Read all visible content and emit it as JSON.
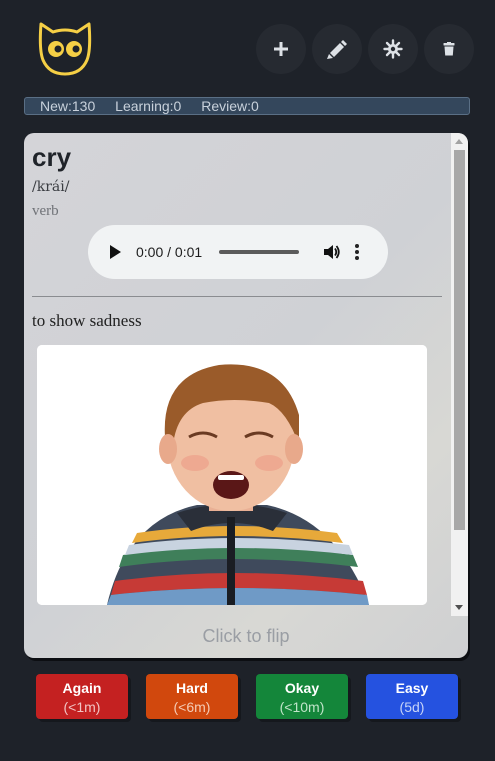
{
  "app": {
    "logo_icon": "owl-icon",
    "toolbar": [
      {
        "name": "add-card-button",
        "icon": "plus-icon"
      },
      {
        "name": "edit-card-button",
        "icon": "pencil-icon"
      },
      {
        "name": "settings-button",
        "icon": "gear-icon"
      },
      {
        "name": "delete-card-button",
        "icon": "trash-icon"
      }
    ]
  },
  "stats": {
    "new": "New:130",
    "learning": "Learning:0",
    "review": "Review:0"
  },
  "card": {
    "word": "cry",
    "pronunciation": "/krái/",
    "part_of_speech": "verb",
    "audio": {
      "time": "0:00 / 0:01"
    },
    "definition": "to show sadness",
    "image_alt": "crying child",
    "flip_hint": "Click to flip"
  },
  "answers": [
    {
      "label": "Again",
      "interval": "(<1m)",
      "color": "#c42121"
    },
    {
      "label": "Hard",
      "interval": "(<6m)",
      "color": "#d1480d"
    },
    {
      "label": "Okay",
      "interval": "(<10m)",
      "color": "#14863a"
    },
    {
      "label": "Easy",
      "interval": "(5d)",
      "color": "#2552e0"
    }
  ],
  "colors": {
    "background": "#1e2229",
    "accent": "#f5cf45",
    "stats_bar": "#34475c"
  }
}
